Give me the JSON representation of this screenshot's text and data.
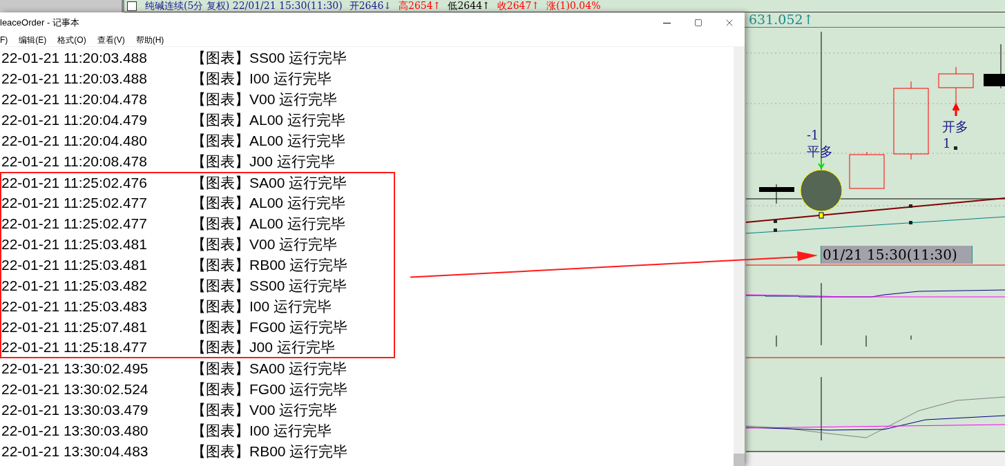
{
  "quote_bar": {
    "segments": [
      {
        "text": "纯碱连续(5分 复权) 22/01/21 15:30(11:30)",
        "color": "#1a1a8c"
      },
      {
        "text": "开2646↓",
        "color": "#1a1a8c"
      },
      {
        "text": "高2654↑",
        "color": "#ff0000"
      },
      {
        "text": "低2644↑",
        "color": "#000000"
      },
      {
        "text": "收2647↑",
        "color": "#ff0000"
      },
      {
        "text": "涨(1)0.04%",
        "color": "#ff0000"
      }
    ],
    "second_line": "631.052↑"
  },
  "notepad": {
    "title": "leaceOrder - 记事本",
    "menu": [
      "F)",
      "编辑(E)",
      "格式(O)",
      "查看(V)",
      "帮助(H)"
    ],
    "lines": [
      {
        "time": "22-01-21 11:20:03.488",
        "message": "【图表】SS00 运行完毕",
        "highlighted": false
      },
      {
        "time": "22-01-21 11:20:03.488",
        "message": "【图表】I00 运行完毕",
        "highlighted": false
      },
      {
        "time": "22-01-21 11:20:04.478",
        "message": "【图表】V00 运行完毕",
        "highlighted": false
      },
      {
        "time": "22-01-21 11:20:04.479",
        "message": "【图表】AL00 运行完毕",
        "highlighted": false
      },
      {
        "time": "22-01-21 11:20:04.480",
        "message": "【图表】AL00 运行完毕",
        "highlighted": false
      },
      {
        "time": "22-01-21 11:20:08.478",
        "message": "【图表】J00 运行完毕",
        "highlighted": false
      },
      {
        "time": "22-01-21 11:25:02.476",
        "message": "【图表】SA00 运行完毕",
        "highlighted": true
      },
      {
        "time": "22-01-21 11:25:02.477",
        "message": "【图表】AL00 运行完毕",
        "highlighted": true
      },
      {
        "time": "22-01-21 11:25:02.477",
        "message": "【图表】AL00 运行完毕",
        "highlighted": true
      },
      {
        "time": "22-01-21 11:25:03.481",
        "message": "【图表】V00 运行完毕",
        "highlighted": true
      },
      {
        "time": "22-01-21 11:25:03.481",
        "message": "【图表】RB00 运行完毕",
        "highlighted": true
      },
      {
        "time": "22-01-21 11:25:03.482",
        "message": "【图表】SS00 运行完毕",
        "highlighted": true
      },
      {
        "time": "22-01-21 11:25:03.483",
        "message": "【图表】I00 运行完毕",
        "highlighted": true
      },
      {
        "time": "22-01-21 11:25:07.481",
        "message": "【图表】FG00 运行完毕",
        "highlighted": true
      },
      {
        "time": "22-01-21 11:25:18.477",
        "message": "【图表】J00 运行完毕",
        "highlighted": true
      },
      {
        "time": "22-01-21 13:30:02.495",
        "message": "【图表】SA00 运行完毕",
        "highlighted": false
      },
      {
        "time": "22-01-21 13:30:02.524",
        "message": "【图表】FG00 运行完毕",
        "highlighted": false
      },
      {
        "time": "22-01-21 13:30:03.479",
        "message": "【图表】V00 运行完毕",
        "highlighted": false
      },
      {
        "time": "22-01-21 13:30:03.480",
        "message": "【图表】I00 运行完毕",
        "highlighted": false
      },
      {
        "time": "22-01-21 13:30:04.483",
        "message": "【图表】RB00 运行完毕",
        "highlighted": false
      }
    ]
  },
  "chart": {
    "close_signal": {
      "qty": "-1",
      "label": "平多"
    },
    "open_signal": {
      "label": "开多",
      "qty": "1"
    },
    "time_label": "01/21 15:30(11:30)"
  }
}
